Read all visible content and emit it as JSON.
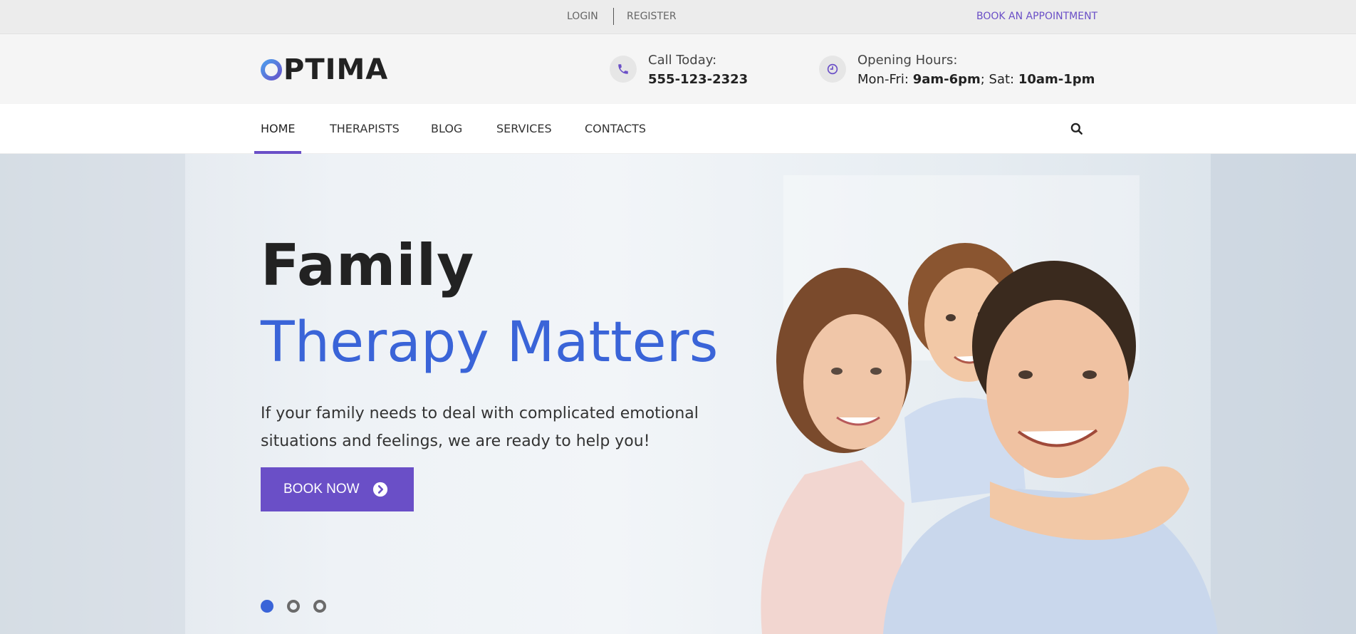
{
  "topbar": {
    "login": "LOGIN",
    "register": "REGISTER",
    "book_appointment": "BOOK AN APPOINTMENT"
  },
  "header": {
    "logo_letter": "O",
    "logo_text": "PTIMA",
    "call": {
      "icon": "phone-icon",
      "label": "Call Today:",
      "phone": "555-123-2323"
    },
    "hours": {
      "icon": "clock-icon",
      "label": "Opening Hours:",
      "weekday_label": "Mon-Fri: ",
      "weekday_hours": "9am-6pm",
      "sep": "; Sat: ",
      "sat_hours": "10am-1pm"
    }
  },
  "nav": {
    "items": [
      {
        "label": "HOME",
        "active": true
      },
      {
        "label": "THERAPISTS",
        "active": false
      },
      {
        "label": "BLOG",
        "active": false
      },
      {
        "label": "SERVICES",
        "active": false
      },
      {
        "label": "CONTACTS",
        "active": false
      }
    ],
    "search_icon": "search-icon"
  },
  "hero": {
    "title_line1": "Family",
    "title_line2": "Therapy Matters",
    "description": "If your family needs to deal with complicated emotional situations and feelings, we are ready to help you!",
    "button_label": "BOOK NOW",
    "slides": 3,
    "active_slide": 1
  },
  "colors": {
    "accent": "#6a4fc7",
    "blue": "#3a64d8",
    "text": "#222222"
  }
}
